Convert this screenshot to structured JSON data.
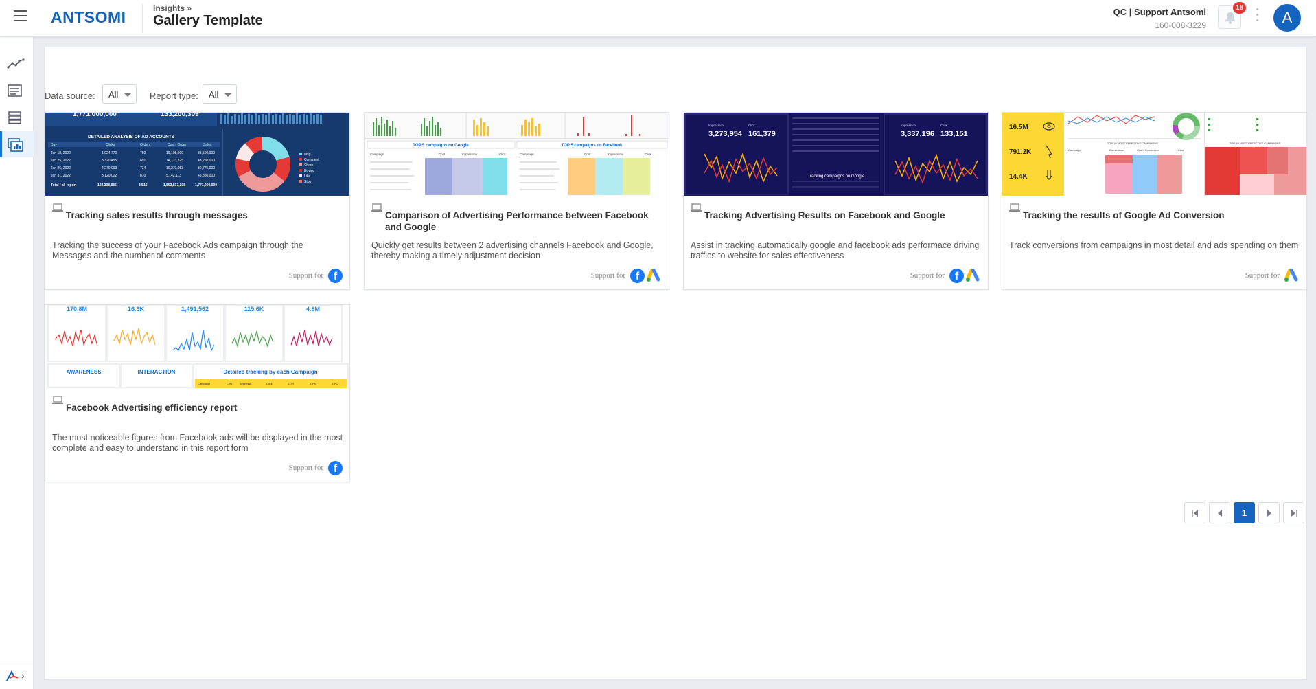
{
  "header": {
    "logo": "ANTSOMI",
    "breadcrumb": "Insights »",
    "title": "Gallery Template",
    "account_name": "QC | Support Antsomi",
    "account_id": "160-008-3229",
    "notification_count": "18",
    "avatar_letter": "A"
  },
  "sidebar": {
    "items": [
      {
        "icon": "line-chart-icon"
      },
      {
        "icon": "report-list-icon"
      },
      {
        "icon": "server-stack-icon"
      },
      {
        "icon": "gallery-icon",
        "active": true
      }
    ],
    "bottom_icon": "antsomi-mark-icon"
  },
  "filters": {
    "data_source_label": "Data source:",
    "data_source_value": "All",
    "report_type_label": "Report type:",
    "report_type_value": "All"
  },
  "support_label": "Support for",
  "cards": [
    {
      "title": "Tracking sales results through messages",
      "description": "Tracking the success of your Facebook Ads campaign through the Messages and the number of comments",
      "platforms": [
        "facebook"
      ],
      "thumb": {
        "kpis": [
          "1,771,000,000",
          "133,200,309"
        ],
        "table_title": "DETAILED ANALYSIS OF AD ACCOUNTS",
        "columns": [
          "Day",
          "Clicks",
          "Orders",
          "Cost / Order",
          "Sales"
        ],
        "rows": [
          [
            "Jan 18, 2022",
            "1,024,770",
            "750",
            "19,105,000",
            "33,500,000"
          ],
          [
            "Jan 25, 2022",
            "3,320,455",
            "891",
            "14,723,325",
            "43,250,000"
          ],
          [
            "Jan 26, 2022",
            "4,270,093",
            "734",
            "10,270,053",
            "30,775,000"
          ],
          [
            "Jan 31, 2022",
            "3,120,022",
            "870",
            "5,142,113",
            "45,350,000"
          ]
        ],
        "total": [
          "Total / all report",
          "193,308,885",
          "3,515",
          "1,553,817,105",
          "1,771,000,000"
        ],
        "legend": [
          "Msg",
          "Comment",
          "Share",
          "Buying",
          "Like",
          "Stop"
        ]
      }
    },
    {
      "title": "Comparison of Advertising Performance between Facebook and Google",
      "description": "Quickly get results between 2 advertising channels Facebook and Google, thereby making a timely adjustment decision",
      "platforms": [
        "facebook",
        "google-ads"
      ],
      "thumb": {
        "google_table_title": "TOP 5 campaigns on Google",
        "facebook_table_title": "TOP 5 campaigns on Facebook",
        "columns": [
          "Campaign",
          "Cost",
          "Impression",
          "Click"
        ]
      }
    },
    {
      "title": "Tracking Advertising Results on Facebook and Google",
      "description": "Assist in tracking automatically google and facebook ads performace driving traffics to website for sales effectiveness",
      "platforms": [
        "facebook",
        "google-ads"
      ],
      "thumb": {
        "left_labels": [
          "Impression",
          "Click"
        ],
        "left_values": [
          "3,273,954",
          "161,379"
        ],
        "right_labels": [
          "Impression",
          "Click"
        ],
        "right_values": [
          "3,337,196",
          "133,151"
        ],
        "center_caption": "Tracking campaigns on Google"
      }
    },
    {
      "title": "Tracking the results of Google Ad Conversion",
      "description": "Track conversions from campaigns in most detail and ads spending on them",
      "platforms": [
        "google-ads"
      ],
      "thumb": {
        "kpis": [
          "16.5M",
          "791.2K",
          "14.4K"
        ],
        "table_title": "TOP 10 MOST EFFECTIVE CAMPAIGNS",
        "treemap_title": "TOP 10 MOST EFFECTIVE CAMPAIGNS",
        "columns": [
          "Campaign",
          "Conversions",
          "Cost / Conversion",
          "Cost"
        ]
      }
    },
    {
      "title": "Facebook Advertising efficiency report",
      "description": "The most noticeable figures from Facebook ads will be displayed in the most complete and easy to understand in this report form",
      "platforms": [
        "facebook"
      ],
      "thumb": {
        "kpis": [
          "170.8M",
          "16.3K",
          "1,491,562",
          "115.6K",
          "4.8M"
        ],
        "kpi_colors": [
          "#e53935",
          "#f9a825",
          "#1e88e5",
          "#43a047",
          "#c2185b"
        ],
        "sections": [
          "AWARENESS",
          "INTERACTION",
          "Detailed tracking by each Campaign"
        ],
        "columns": [
          "Campaign",
          "Cost",
          "Impressi...",
          "Click",
          "CTR",
          "CPM",
          "CPC"
        ]
      }
    }
  ],
  "pagination": {
    "current_page": "1",
    "buttons": [
      "first-page",
      "previous-page",
      "1",
      "next-page",
      "last-page"
    ]
  },
  "colors": {
    "brand": "#1463b8",
    "active_page": "#1565c0",
    "badge": "#e53935",
    "facebook": "#1877f2"
  }
}
